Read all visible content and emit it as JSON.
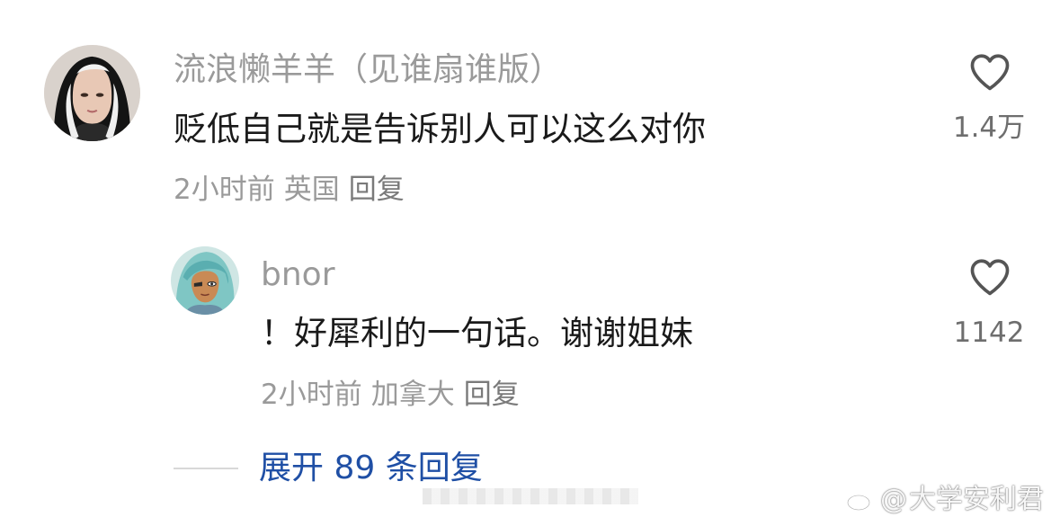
{
  "comments": [
    {
      "username": "流浪懒羊羊（见谁扇谁版）",
      "text": "贬低自己就是告诉别人可以这么对你",
      "time": "2小时前",
      "location": "英国",
      "reply_label": "回复",
      "likes": "1.4万",
      "like_icon": "heart-outline-icon"
    },
    {
      "username": "bnor",
      "text": "！好犀利的一句话。谢谢姐妹",
      "time": "2小时前",
      "location": "加拿大",
      "reply_label": "回复",
      "likes": "1142",
      "like_icon": "heart-outline-icon"
    }
  ],
  "expand_replies": "展开 89 条回复",
  "watermark": {
    "at": "@",
    "account": "大学安利君",
    "logo": "weibo-logo-icon"
  },
  "colors": {
    "username": "#9a9a9a",
    "content": "#1a1a1a",
    "meta": "#9a9a9a",
    "link": "#1f4fa5",
    "icon": "#555555"
  }
}
